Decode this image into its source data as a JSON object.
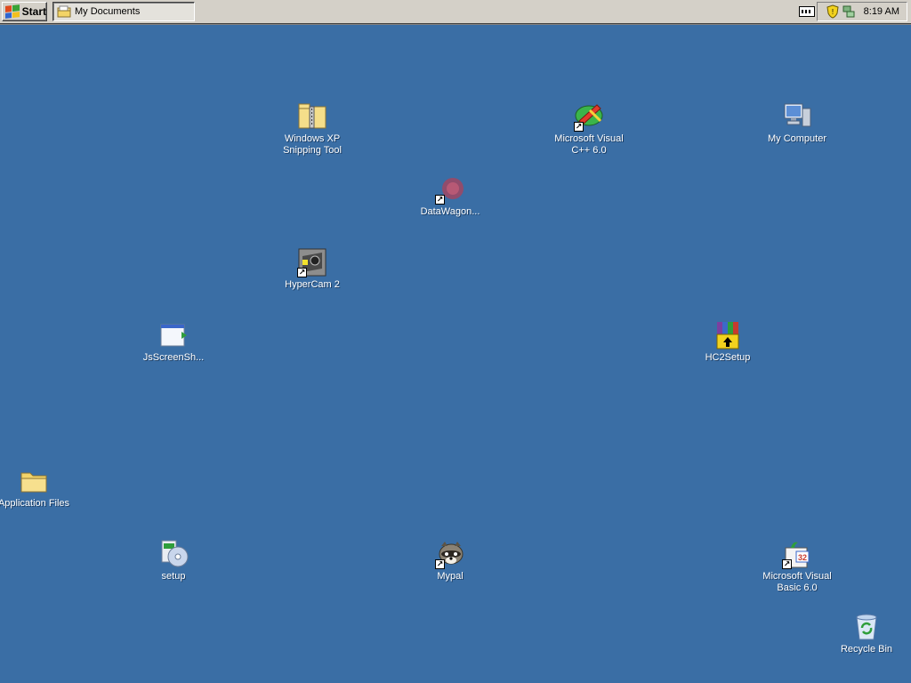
{
  "taskbar": {
    "start_label": "Start",
    "window_button_label": "My Documents",
    "clock": "8:19 AM"
  },
  "desktop": {
    "icons": [
      {
        "label": "Windows XP Snipping Tool",
        "icon": "zip-folder-icon"
      },
      {
        "label": "Microsoft Visual C++ 6.0",
        "icon": "visual-cpp-icon"
      },
      {
        "label": "My Computer",
        "icon": "computer-icon"
      },
      {
        "label": "DataWagon...",
        "icon": "datawagon-icon"
      },
      {
        "label": "HyperCam 2",
        "icon": "hypercam-icon"
      },
      {
        "label": "JsScreenSh...",
        "icon": "application-icon"
      },
      {
        "label": "HC2Setup",
        "icon": "winrar-setup-icon"
      },
      {
        "label": "Application Files",
        "icon": "folder-icon"
      },
      {
        "label": "setup",
        "icon": "setup-cd-icon"
      },
      {
        "label": "Mypal",
        "icon": "raccoon-icon"
      },
      {
        "label": "Microsoft Visual Basic 6.0",
        "icon": "visual-basic-icon"
      },
      {
        "label": "Recycle Bin",
        "icon": "recycle-bin-icon"
      }
    ]
  },
  "colors": {
    "desktop_background": "#3a6ea5",
    "taskbar": "#d4d0c8"
  }
}
